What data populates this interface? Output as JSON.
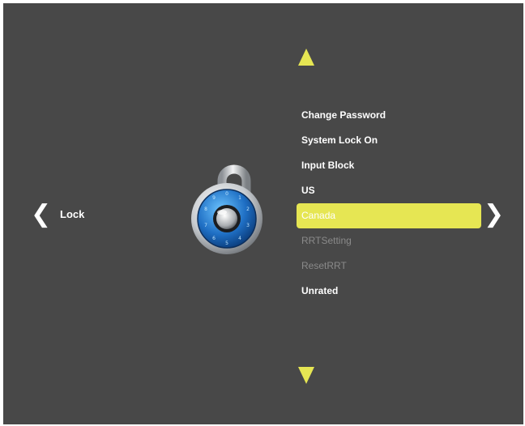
{
  "nav": {
    "left_chevron": "❮",
    "right_chevron": "❯",
    "category_label": "Lock"
  },
  "menu": {
    "items": [
      {
        "label": "Change Password",
        "state": "normal"
      },
      {
        "label": "System Lock On",
        "state": "normal"
      },
      {
        "label": "Input Block",
        "state": "normal"
      },
      {
        "label": "US",
        "state": "normal"
      },
      {
        "label": "Canada",
        "state": "selected"
      },
      {
        "label": "RRTSetting",
        "state": "disabled"
      },
      {
        "label": "ResetRRT",
        "state": "disabled"
      },
      {
        "label": "Unrated",
        "state": "normal"
      }
    ]
  },
  "icons": {
    "category": "combination-padlock-icon",
    "scroll_up": "triangle-up-icon",
    "scroll_down": "triangle-down-icon"
  },
  "colors": {
    "background": "#484848",
    "highlight": "#e6e653",
    "text": "#ffffff",
    "disabled_text": "#8a8a8a"
  }
}
